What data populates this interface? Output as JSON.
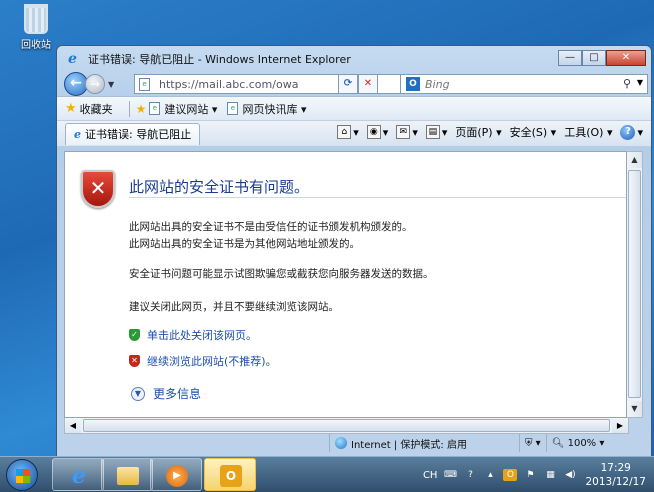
{
  "desktop": {
    "recycle_bin_label": "回收站"
  },
  "window": {
    "title": "证书错误: 导航已阻止 - Windows Internet Explorer",
    "minimize_glyph": "—",
    "maximize_glyph": "□",
    "close_glyph": "✕"
  },
  "nav": {
    "url": "https://mail.abc.com/owa",
    "search_placeholder": "Bing"
  },
  "favorites_bar": {
    "favorites_label": "收藏夹",
    "suggested_sites_label": "建议网站 ▾",
    "web_slice_label": "网页快讯库 ▾"
  },
  "tab": {
    "label": "证书错误: 导航已阻止"
  },
  "command_bar": {
    "page_label": "页面(P) ▾",
    "safety_label": "安全(S) ▾",
    "tools_label": "工具(O) ▾"
  },
  "error_page": {
    "title": "此网站的安全证书有问题。",
    "line1": "此网站出具的安全证书不是由受信任的证书颁发机构颁发的。",
    "line2": "此网站出具的安全证书是为其他网站地址颁发的。",
    "line3": "安全证书问题可能显示试图欺骗您或截获您向服务器发送的数据。",
    "line4": "建议关闭此网页，并且不要继续浏览该网站。",
    "close_link": "单击此处关闭该网页。",
    "continue_link": "继续浏览此网站(不推荐)。",
    "more_info": "更多信息"
  },
  "status_bar": {
    "zone": "Internet | 保护模式: 启用",
    "zoom": "100%"
  },
  "tray": {
    "lang": "CH",
    "time": "17:29",
    "date": "2013/12/17"
  },
  "colors": {
    "link": "#1b4eab",
    "error_title": "#1a3c8c",
    "error_red": "#c5281b",
    "ok_green": "#2c9a34"
  }
}
